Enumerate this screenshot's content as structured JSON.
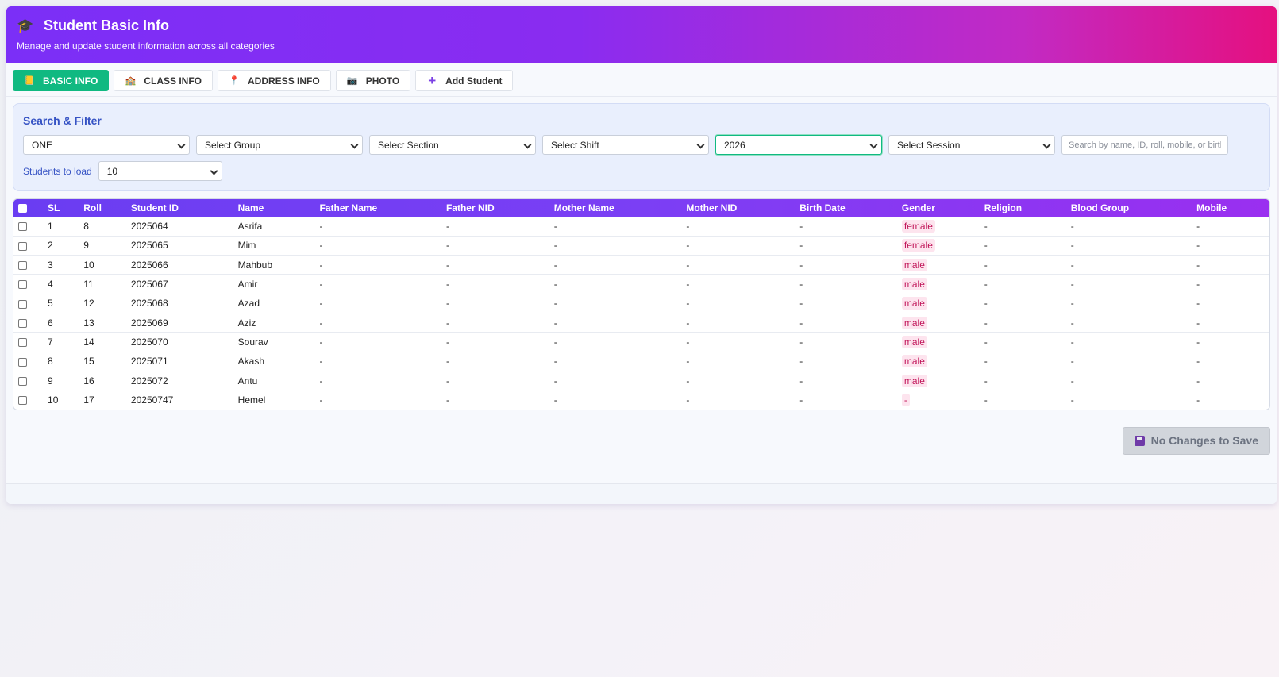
{
  "header": {
    "title": "Student Basic Info",
    "subtitle": "Manage and update student information across all categories",
    "icon": "graduation-cap-icon"
  },
  "tabs": [
    {
      "label": "BASIC INFO",
      "icon": "notebook-icon",
      "active": true
    },
    {
      "label": "CLASS INFO",
      "icon": "school-icon",
      "active": false
    },
    {
      "label": "ADDRESS INFO",
      "icon": "pin-icon",
      "active": false
    },
    {
      "label": "PHOTO",
      "icon": "camera-icon",
      "active": false
    },
    {
      "label": "Add Student",
      "icon": "plus-icon",
      "active": false
    }
  ],
  "filter": {
    "title": "Search & Filter",
    "class_value": "ONE",
    "group_value": "Select Group",
    "section_value": "Select Section",
    "shift_value": "Select Shift",
    "year_value": "2026",
    "session_value": "Select Session",
    "search_placeholder": "Search by name, ID, roll, mobile, or birth",
    "students_to_load_label": "Students to load",
    "students_to_load_value": "10"
  },
  "table": {
    "columns": [
      "SL",
      "Roll",
      "Student ID",
      "Name",
      "Father Name",
      "Father NID",
      "Mother Name",
      "Mother NID",
      "Birth Date",
      "Gender",
      "Religion",
      "Blood Group",
      "Mobile"
    ],
    "rows": [
      [
        "1",
        "8",
        "2025064",
        "Asrifa",
        "-",
        "-",
        "-",
        "-",
        "-",
        "female",
        "-",
        "-",
        "-"
      ],
      [
        "2",
        "9",
        "2025065",
        "Mim",
        "-",
        "-",
        "-",
        "-",
        "-",
        "female",
        "-",
        "-",
        "-"
      ],
      [
        "3",
        "10",
        "2025066",
        "Mahbub",
        "-",
        "-",
        "-",
        "-",
        "-",
        "male",
        "-",
        "-",
        "-"
      ],
      [
        "4",
        "11",
        "2025067",
        "Amir",
        "-",
        "-",
        "-",
        "-",
        "-",
        "male",
        "-",
        "-",
        "-"
      ],
      [
        "5",
        "12",
        "2025068",
        "Azad",
        "-",
        "-",
        "-",
        "-",
        "-",
        "male",
        "-",
        "-",
        "-"
      ],
      [
        "6",
        "13",
        "2025069",
        "Aziz",
        "-",
        "-",
        "-",
        "-",
        "-",
        "male",
        "-",
        "-",
        "-"
      ],
      [
        "7",
        "14",
        "2025070",
        "Sourav",
        "-",
        "-",
        "-",
        "-",
        "-",
        "male",
        "-",
        "-",
        "-"
      ],
      [
        "8",
        "15",
        "2025071",
        "Akash",
        "-",
        "-",
        "-",
        "-",
        "-",
        "male",
        "-",
        "-",
        "-"
      ],
      [
        "9",
        "16",
        "2025072",
        "Antu",
        "-",
        "-",
        "-",
        "-",
        "-",
        "male",
        "-",
        "-",
        "-"
      ],
      [
        "10",
        "17",
        "20250747",
        "Hemel",
        "-",
        "-",
        "-",
        "-",
        "-",
        "-",
        "-",
        "-",
        "-"
      ]
    ]
  },
  "save_button": {
    "label": "No Changes to Save",
    "icon": "floppy-disk-icon"
  },
  "colors": {
    "accent_green": "#10b981",
    "header_gradient_start": "#7b2ff7",
    "header_gradient_end": "#e5107f",
    "table_header": "#6a3df2",
    "gender_badge_bg": "#fde4ee",
    "gender_badge_text": "#c2185b"
  }
}
